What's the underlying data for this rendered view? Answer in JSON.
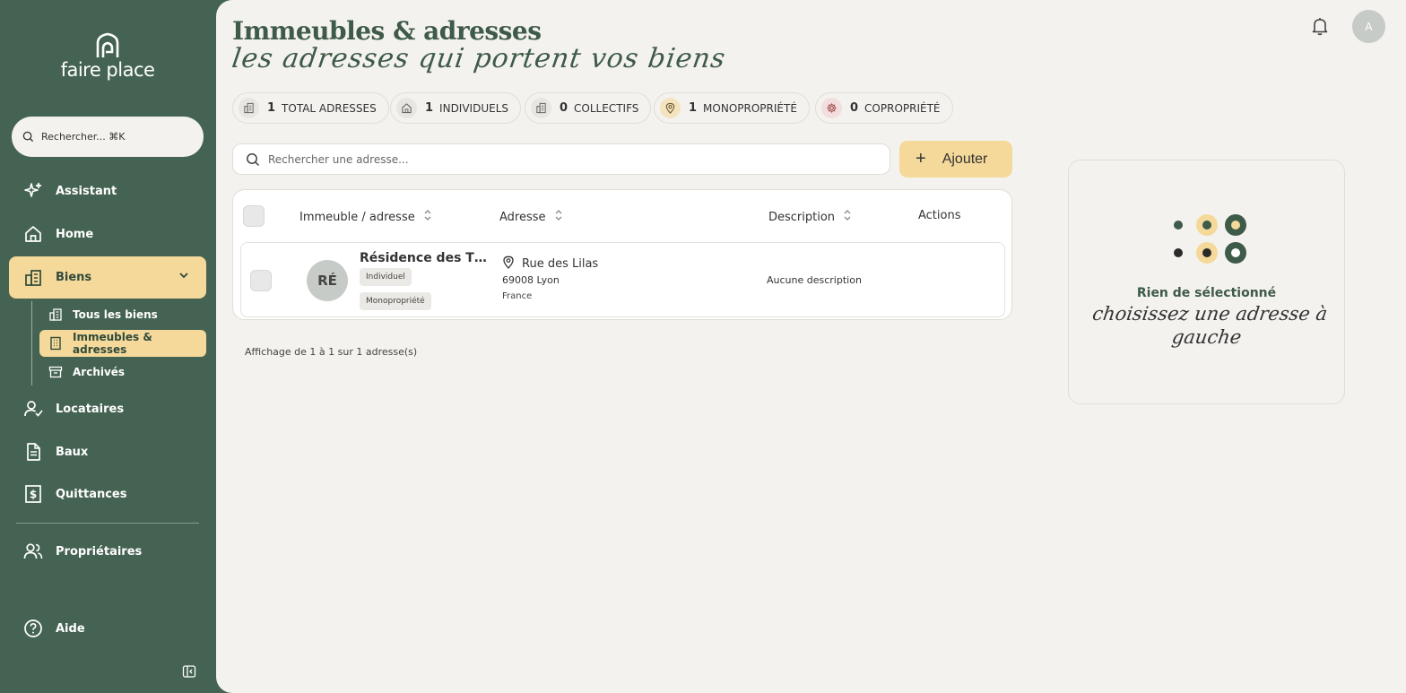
{
  "sidebar": {
    "logo_text": "faire place",
    "search_placeholder": "Rechercher... ⌘K",
    "items": [
      {
        "label": "Assistant",
        "icon": "sparkle-icon"
      },
      {
        "label": "Home",
        "icon": "home-icon"
      },
      {
        "label": "Biens",
        "icon": "building-icon"
      },
      {
        "label": "Locataires",
        "icon": "user-check-icon"
      },
      {
        "label": "Baux",
        "icon": "document-icon"
      },
      {
        "label": "Quittances",
        "icon": "receipt-dollar-icon"
      },
      {
        "label": "Propriétaires",
        "icon": "users-icon"
      },
      {
        "label": "Aide",
        "icon": "help-circle-icon"
      }
    ],
    "sub_items": [
      {
        "label": "Tous les biens",
        "icon": "buildings-icon"
      },
      {
        "label": "Immeubles & adresses",
        "icon": "building-grid-icon"
      },
      {
        "label": "Archivés",
        "icon": "archive-icon"
      }
    ]
  },
  "header": {
    "title": "Immeubles & adresses",
    "subtitle": "les adresses qui portent vos biens",
    "avatar_initial": "A"
  },
  "stats": [
    {
      "count": "1",
      "label": "TOTAL ADRESSES",
      "icon": "building-icon"
    },
    {
      "count": "1",
      "label": "INDIVIDUELS",
      "icon": "home-icon"
    },
    {
      "count": "0",
      "label": "COLLECTIFS",
      "icon": "building-icon"
    },
    {
      "count": "1",
      "label": "MONOPROPRIÉTÉ",
      "icon": "map-pin-icon"
    },
    {
      "count": "0",
      "label": "COPROPRIÉTÉ",
      "icon": "gear-icon"
    }
  ],
  "toolbar": {
    "search_placeholder": "Rechercher une adresse...",
    "add_label": "Ajouter"
  },
  "table": {
    "columns": [
      "Immeuble / adresse",
      "Adresse",
      "Description",
      "Actions"
    ],
    "rows": [
      {
        "initials": "RÉ",
        "name": "Résidence des Tilleuls",
        "tags": [
          "Individuel",
          "Monopropriété"
        ],
        "street": "Rue des Lilas",
        "city": "69008 Lyon",
        "country": "France",
        "description": "Aucune description"
      }
    ]
  },
  "pagination_info": "Affichage de 1 à 1 sur 1 adresse(s)",
  "detail_panel": {
    "title": "Rien de sélectionné",
    "subtitle": "choisissez une adresse à gauche"
  },
  "colors": {
    "sidebar_bg": "#456352",
    "accent_yellow": "#f5d99a",
    "primary_green": "#3e5a48",
    "page_bg": "#f4f2ee"
  }
}
